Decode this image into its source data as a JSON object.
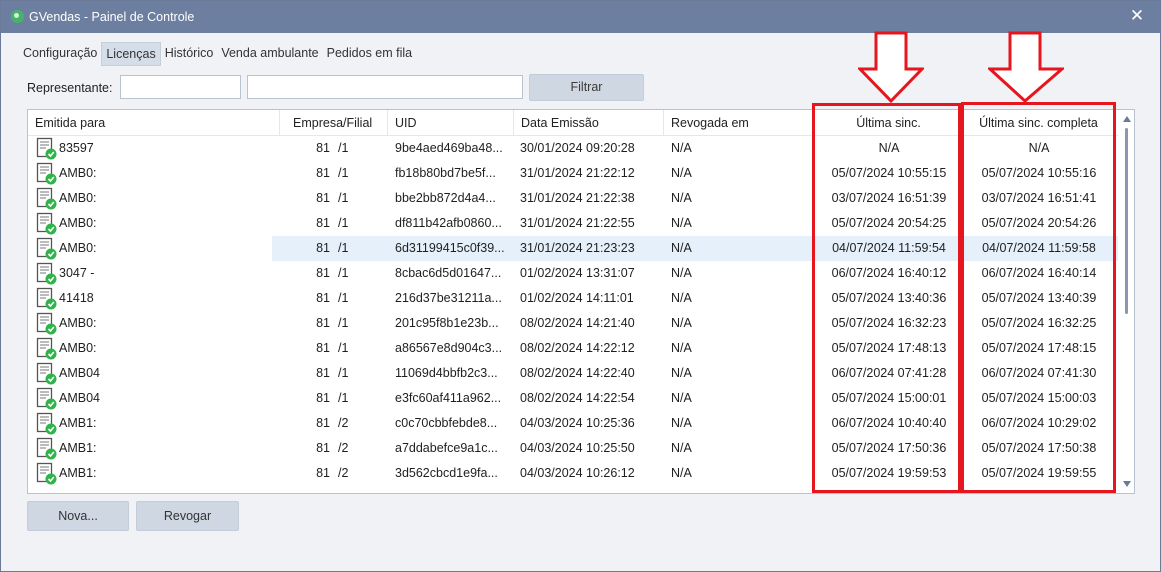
{
  "window": {
    "title": "GVendas - Painel de Controle"
  },
  "menu": [
    {
      "label": "Configuração"
    },
    {
      "label": "Licenças"
    },
    {
      "label": "Histórico"
    },
    {
      "label": "Venda ambulante"
    },
    {
      "label": "Pedidos em fila"
    }
  ],
  "filter": {
    "label": "Representante:",
    "button": "Filtrar"
  },
  "columns": [
    "Emitida para",
    "Empresa/Filial",
    "UID",
    "Data Emissão",
    "Revogada em",
    "Última sinc.",
    "Última sinc. completa"
  ],
  "rows": [
    {
      "emitida": "83597",
      "empresa": "81",
      "filial": "/1",
      "uid": "9be4aed469ba48...",
      "emissao": "30/01/2024 09:20:28",
      "revogada": "N/A",
      "sinc": "N/A",
      "sinc_completa": "N/A"
    },
    {
      "emitida": "AMB0:",
      "empresa": "81",
      "filial": "/1",
      "uid": "fb18b80bd7be5f...",
      "emissao": "31/01/2024 21:22:12",
      "revogada": "N/A",
      "sinc": "05/07/2024 10:55:15",
      "sinc_completa": "05/07/2024 10:55:16"
    },
    {
      "emitida": "AMB0:",
      "empresa": "81",
      "filial": "/1",
      "uid": "bbe2bb872d4a4...",
      "emissao": "31/01/2024 21:22:38",
      "revogada": "N/A",
      "sinc": "03/07/2024 16:51:39",
      "sinc_completa": "03/07/2024 16:51:41"
    },
    {
      "emitida": "AMB0:",
      "empresa": "81",
      "filial": "/1",
      "uid": "df811b42afb0860...",
      "emissao": "31/01/2024 21:22:55",
      "revogada": "N/A",
      "sinc": "05/07/2024 20:54:25",
      "sinc_completa": "05/07/2024 20:54:26"
    },
    {
      "emitida": "AMB0:",
      "empresa": "81",
      "filial": "/1",
      "uid": "6d31199415c0f39...",
      "emissao": "31/01/2024 21:23:23",
      "revogada": "N/A",
      "sinc": "04/07/2024 11:59:54",
      "sinc_completa": "04/07/2024 11:59:58"
    },
    {
      "emitida": "3047 -",
      "empresa": "81",
      "filial": "/1",
      "uid": "8cbac6d5d01647...",
      "emissao": "01/02/2024 13:31:07",
      "revogada": "N/A",
      "sinc": "06/07/2024 16:40:12",
      "sinc_completa": "06/07/2024 16:40:14"
    },
    {
      "emitida": "41418",
      "empresa": "81",
      "filial": "/1",
      "uid": "216d37be31211a...",
      "emissao": "01/02/2024 14:11:01",
      "revogada": "N/A",
      "sinc": "05/07/2024 13:40:36",
      "sinc_completa": "05/07/2024 13:40:39"
    },
    {
      "emitida": "AMB0:",
      "empresa": "81",
      "filial": "/1",
      "uid": "201c95f8b1e23b...",
      "emissao": "08/02/2024 14:21:40",
      "revogada": "N/A",
      "sinc": "05/07/2024 16:32:23",
      "sinc_completa": "05/07/2024 16:32:25"
    },
    {
      "emitida": "AMB0:",
      "empresa": "81",
      "filial": "/1",
      "uid": "a86567e8d904c3...",
      "emissao": "08/02/2024 14:22:12",
      "revogada": "N/A",
      "sinc": "05/07/2024 17:48:13",
      "sinc_completa": "05/07/2024 17:48:15"
    },
    {
      "emitida": "AMB04",
      "empresa": "81",
      "filial": "/1",
      "uid": "11069d4bbfb2c3...",
      "emissao": "08/02/2024 14:22:40",
      "revogada": "N/A",
      "sinc": "06/07/2024 07:41:28",
      "sinc_completa": "06/07/2024 07:41:30"
    },
    {
      "emitida": "AMB04",
      "empresa": "81",
      "filial": "/1",
      "uid": "e3fc60af411a962...",
      "emissao": "08/02/2024 14:22:54",
      "revogada": "N/A",
      "sinc": "05/07/2024 15:00:01",
      "sinc_completa": "05/07/2024 15:00:03"
    },
    {
      "emitida": "AMB1:",
      "empresa": "81",
      "filial": "/2",
      "uid": "c0c70cbbfebde8...",
      "emissao": "04/03/2024 10:25:36",
      "revogada": "N/A",
      "sinc": "06/07/2024 10:40:40",
      "sinc_completa": "06/07/2024 10:29:02"
    },
    {
      "emitida": "AMB1:",
      "empresa": "81",
      "filial": "/2",
      "uid": "a7ddabefce9a1c...",
      "emissao": "04/03/2024 10:25:50",
      "revogada": "N/A",
      "sinc": "05/07/2024 17:50:36",
      "sinc_completa": "05/07/2024 17:50:38"
    },
    {
      "emitida": "AMB1:",
      "empresa": "81",
      "filial": "/2",
      "uid": "3d562cbcd1e9fa...",
      "emissao": "04/03/2024 10:26:12",
      "revogada": "N/A",
      "sinc": "05/07/2024 19:59:53",
      "sinc_completa": "05/07/2024 19:59:55"
    }
  ],
  "buttons": {
    "nova": "Nova...",
    "revogar": "Revogar"
  },
  "colors": {
    "titlebar": "#6d7fa0",
    "highlight": "#e5161d",
    "selected_row": "#e6f0fa",
    "license_ok": "#2fb34a"
  }
}
